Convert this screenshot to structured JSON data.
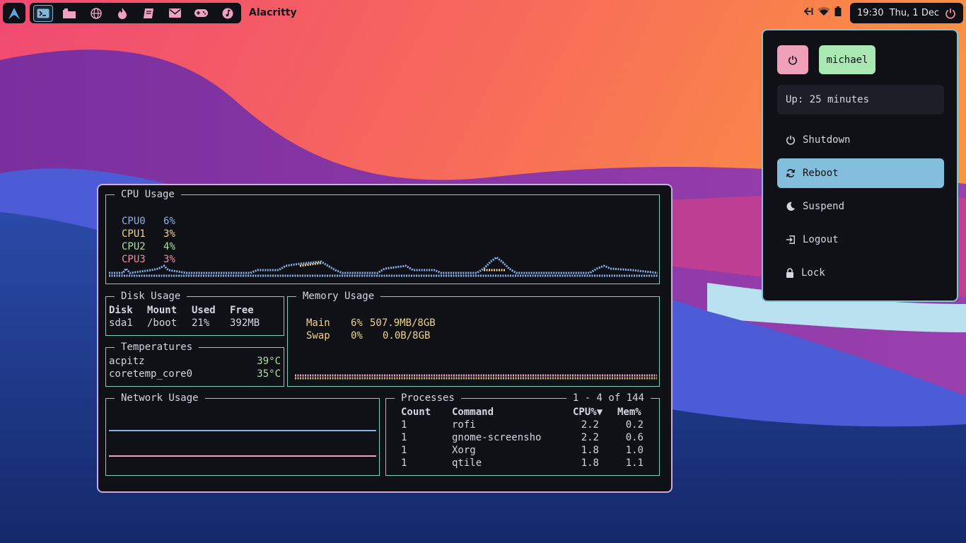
{
  "taskbar": {
    "launcher_icon": "arch-linux-icon",
    "apps": [
      {
        "icon": "terminal-icon",
        "active": true
      },
      {
        "icon": "folder-icon"
      },
      {
        "icon": "globe-icon"
      },
      {
        "icon": "flame-icon"
      },
      {
        "icon": "book-icon"
      },
      {
        "icon": "mail-icon"
      },
      {
        "icon": "gamepad-icon"
      },
      {
        "icon": "music-icon"
      }
    ],
    "window_title": "Alacritty",
    "clock": "19:30  Thu, 1 Dec",
    "tray_icons": [
      "arrow-left-bar-icon",
      "wifi-icon",
      "battery-icon"
    ]
  },
  "terminal": {
    "cpu": {
      "title": "CPU Usage",
      "cores": [
        {
          "name": "CPU0",
          "value": "6%",
          "color": "#8bb0e8"
        },
        {
          "name": "CPU1",
          "value": "3%",
          "color": "#efd48a"
        },
        {
          "name": "CPU2",
          "value": "4%",
          "color": "#a9e0a0"
        },
        {
          "name": "CPU3",
          "value": "3%",
          "color": "#f08ca0"
        }
      ]
    },
    "disk": {
      "title": "Disk Usage",
      "headers": [
        "Disk",
        "Mount",
        "Used",
        "Free"
      ],
      "rows": [
        [
          "sda1",
          "/boot",
          "21%",
          "392MB"
        ]
      ]
    },
    "temps": {
      "title": "Temperatures",
      "rows": [
        [
          "acpitz",
          "39°C"
        ],
        [
          "coretemp_core0",
          "35°C"
        ]
      ]
    },
    "memory": {
      "title": "Memory Usage",
      "rows": [
        {
          "name": "Main",
          "pct": "6%",
          "val": "507.9MB/8GB"
        },
        {
          "name": "Swap",
          "pct": "0%",
          "val": "0.0B/8GB"
        }
      ]
    },
    "network": {
      "title": "Network Usage"
    },
    "processes": {
      "title": "Processes",
      "range": "1 - 4 of 144",
      "headers": [
        "Count",
        "Command",
        "CPU%▼",
        "Mem%"
      ],
      "rows": [
        [
          "1",
          "rofi",
          "2.2",
          "0.2"
        ],
        [
          "1",
          "gnome-screensho",
          "2.2",
          "0.6"
        ],
        [
          "1",
          "Xorg",
          "1.8",
          "1.0"
        ],
        [
          "1",
          "qtile",
          "1.8",
          "1.1"
        ]
      ]
    }
  },
  "power_menu": {
    "power_button_icon": "power-icon",
    "user": "michael",
    "uptime": "Up: 25 minutes",
    "items": [
      {
        "icon": "power-icon",
        "label": "Shutdown"
      },
      {
        "icon": "refresh-icon",
        "label": "Reboot",
        "selected": true
      },
      {
        "icon": "moon-icon",
        "label": "Suspend"
      },
      {
        "icon": "logout-icon",
        "label": "Logout"
      },
      {
        "icon": "lock-icon",
        "label": "Lock"
      }
    ]
  }
}
